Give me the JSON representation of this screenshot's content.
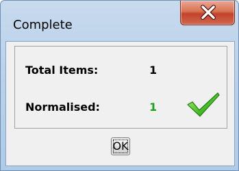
{
  "window": {
    "title": "Complete",
    "close_icon": "close-x-icon"
  },
  "summary": {
    "total_items_label": "Total Items:",
    "total_items_value": "1",
    "normalised_label": "Normalised:",
    "normalised_value": "1",
    "normalised_color": "#1aa21a",
    "status_icon": "checkmark-icon"
  },
  "buttons": {
    "ok_label": "OK"
  }
}
